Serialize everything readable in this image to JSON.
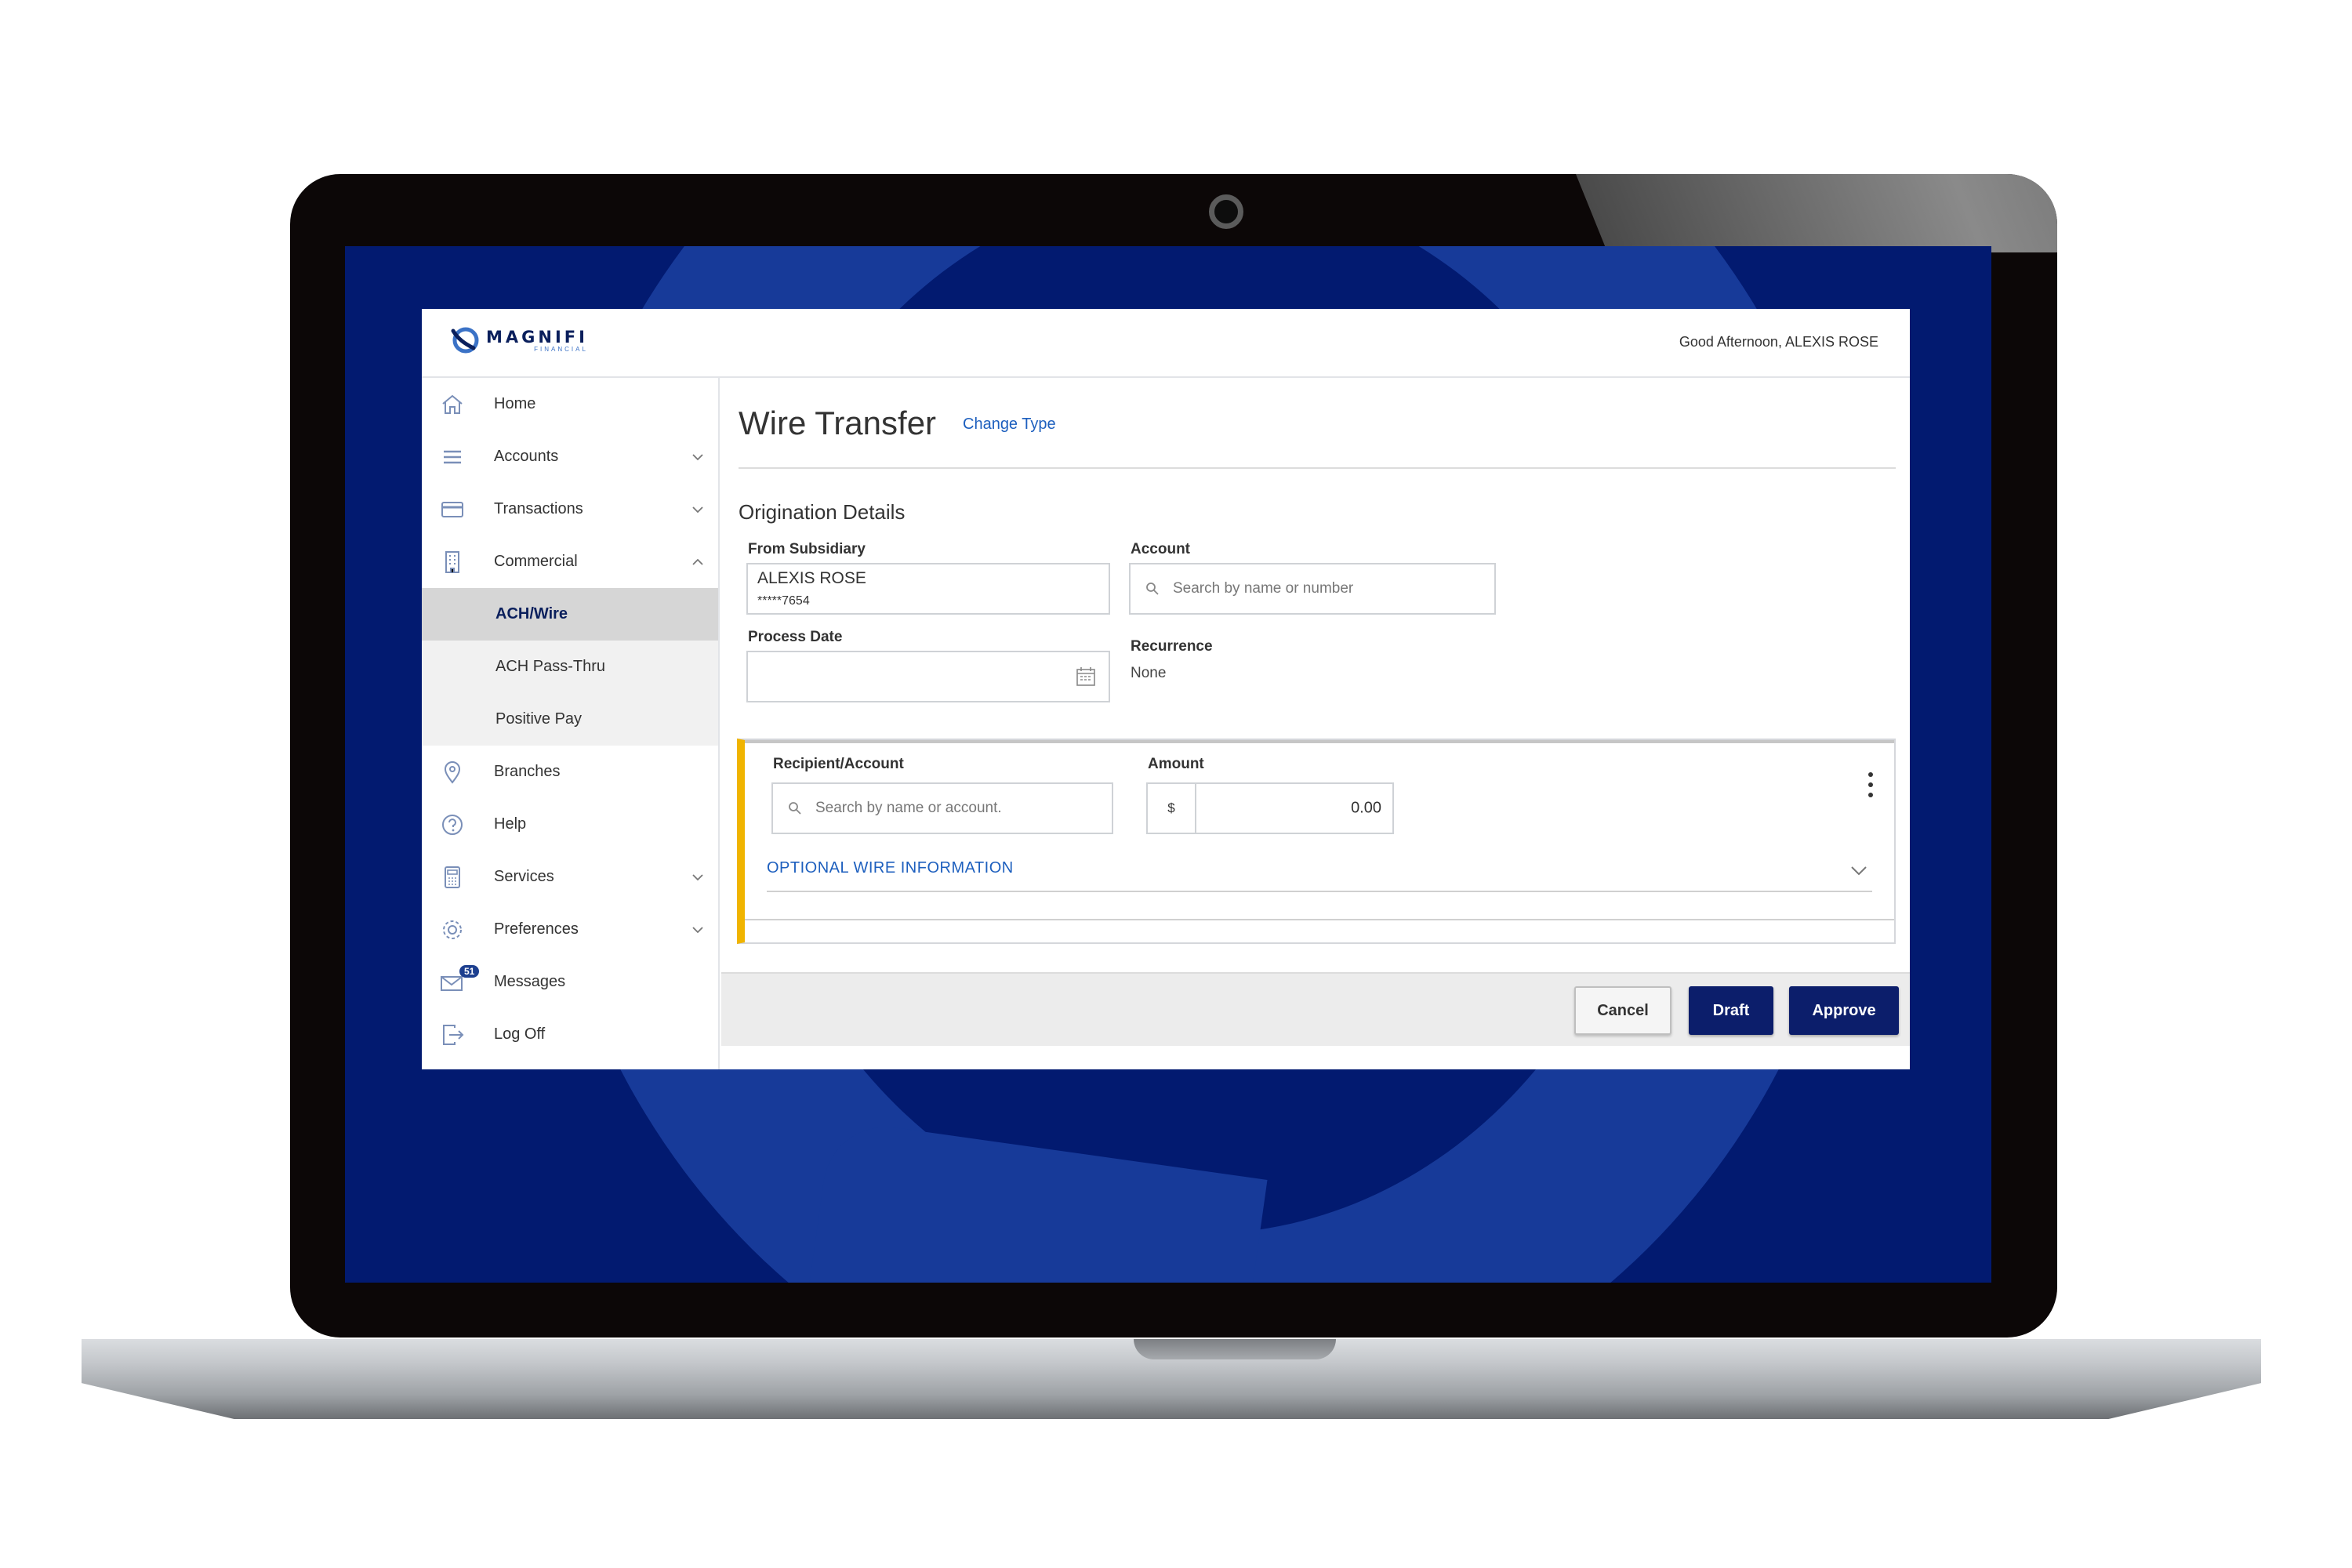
{
  "header": {
    "brand_name": "MAGNIFI",
    "brand_sub": "FINANCIAL",
    "greeting": "Good Afternoon, ALEXIS ROSE"
  },
  "sidebar": {
    "items": [
      {
        "label": "Home",
        "icon": "home-icon"
      },
      {
        "label": "Accounts",
        "icon": "list-icon"
      },
      {
        "label": "Transactions",
        "icon": "card-icon"
      },
      {
        "label": "Commercial",
        "icon": "building-icon"
      },
      {
        "label": "Branches",
        "icon": "map-pin-icon"
      },
      {
        "label": "Help",
        "icon": "help-icon"
      },
      {
        "label": "Services",
        "icon": "calculator-icon"
      },
      {
        "label": "Preferences",
        "icon": "gear-icon"
      },
      {
        "label": "Messages",
        "icon": "mail-icon",
        "badge": "51"
      },
      {
        "label": "Log Off",
        "icon": "logout-icon"
      }
    ],
    "commercial_sub": [
      {
        "label": "ACH/Wire",
        "active": true
      },
      {
        "label": "ACH Pass-Thru"
      },
      {
        "label": "Positive Pay"
      }
    ]
  },
  "main": {
    "title": "Wire Transfer",
    "change_type": "Change Type",
    "section_title": "Origination Details",
    "from_subsidiary": {
      "label": "From Subsidiary",
      "name": "ALEXIS ROSE",
      "account": "*****7654"
    },
    "account": {
      "label": "Account",
      "placeholder": "Search by name or number"
    },
    "process_date": {
      "label": "Process Date",
      "value": ""
    },
    "recurrence": {
      "label": "Recurrence",
      "value": "None"
    },
    "recipient": {
      "label": "Recipient/Account",
      "placeholder": "Search by name or account."
    },
    "amount": {
      "label": "Amount",
      "currency": "$",
      "value": "0.00"
    },
    "optional_wire": "OPTIONAL WIRE INFORMATION"
  },
  "footer": {
    "cancel": "Cancel",
    "draft": "Draft",
    "approve": "Approve"
  },
  "colors": {
    "screen_bg": "#021a70",
    "swirl": "#173a99",
    "primary_button": "#0c1e6b",
    "link": "#1d5fbe",
    "card_accent": "#f0b400"
  }
}
